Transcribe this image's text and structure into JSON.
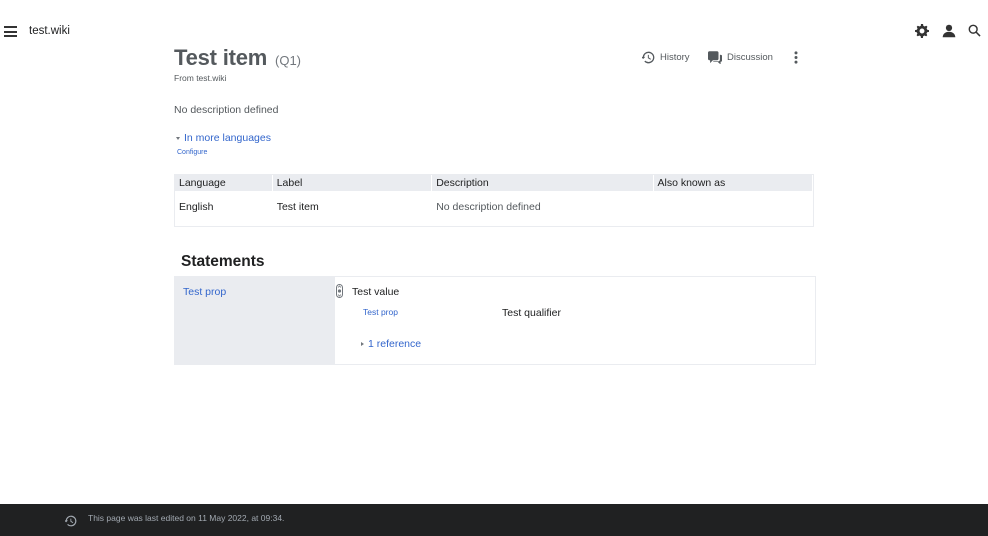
{
  "topbar": {
    "menu_icon": "hamburger-menu-icon",
    "site_name": "test.wiki",
    "icons": [
      "gear-icon",
      "user-icon",
      "search-icon"
    ]
  },
  "item": {
    "title": "Test item",
    "id": "(Q1)",
    "from": "From test.wiki",
    "description": "No description defined"
  },
  "actions": {
    "history_label": "History",
    "discussion_label": "Discussion",
    "history_icon": "history-icon",
    "discussion_icon": "discussion-icon",
    "more_icon": "more-vertical-icon"
  },
  "languages": {
    "toggle_label": "In more languages",
    "configure_label": "Configure",
    "headers": [
      "Language",
      "Label",
      "Description",
      "Also known as"
    ],
    "rows": [
      [
        "English",
        "Test item",
        "No description defined",
        ""
      ]
    ]
  },
  "statements": {
    "heading": "Statements",
    "groups": [
      {
        "property": "Test prop",
        "value": "Test value",
        "qualifier_property": "Test prop",
        "qualifier_value": "Test qualifier",
        "references": "1 reference"
      }
    ]
  },
  "footer": {
    "text": "This page was last edited on 11 May 2022, at 09:34.",
    "icon": "history-icon"
  },
  "colors": {
    "link": "#3366cc",
    "footer_bg": "#202122",
    "header_bg": "#eaecf0"
  }
}
